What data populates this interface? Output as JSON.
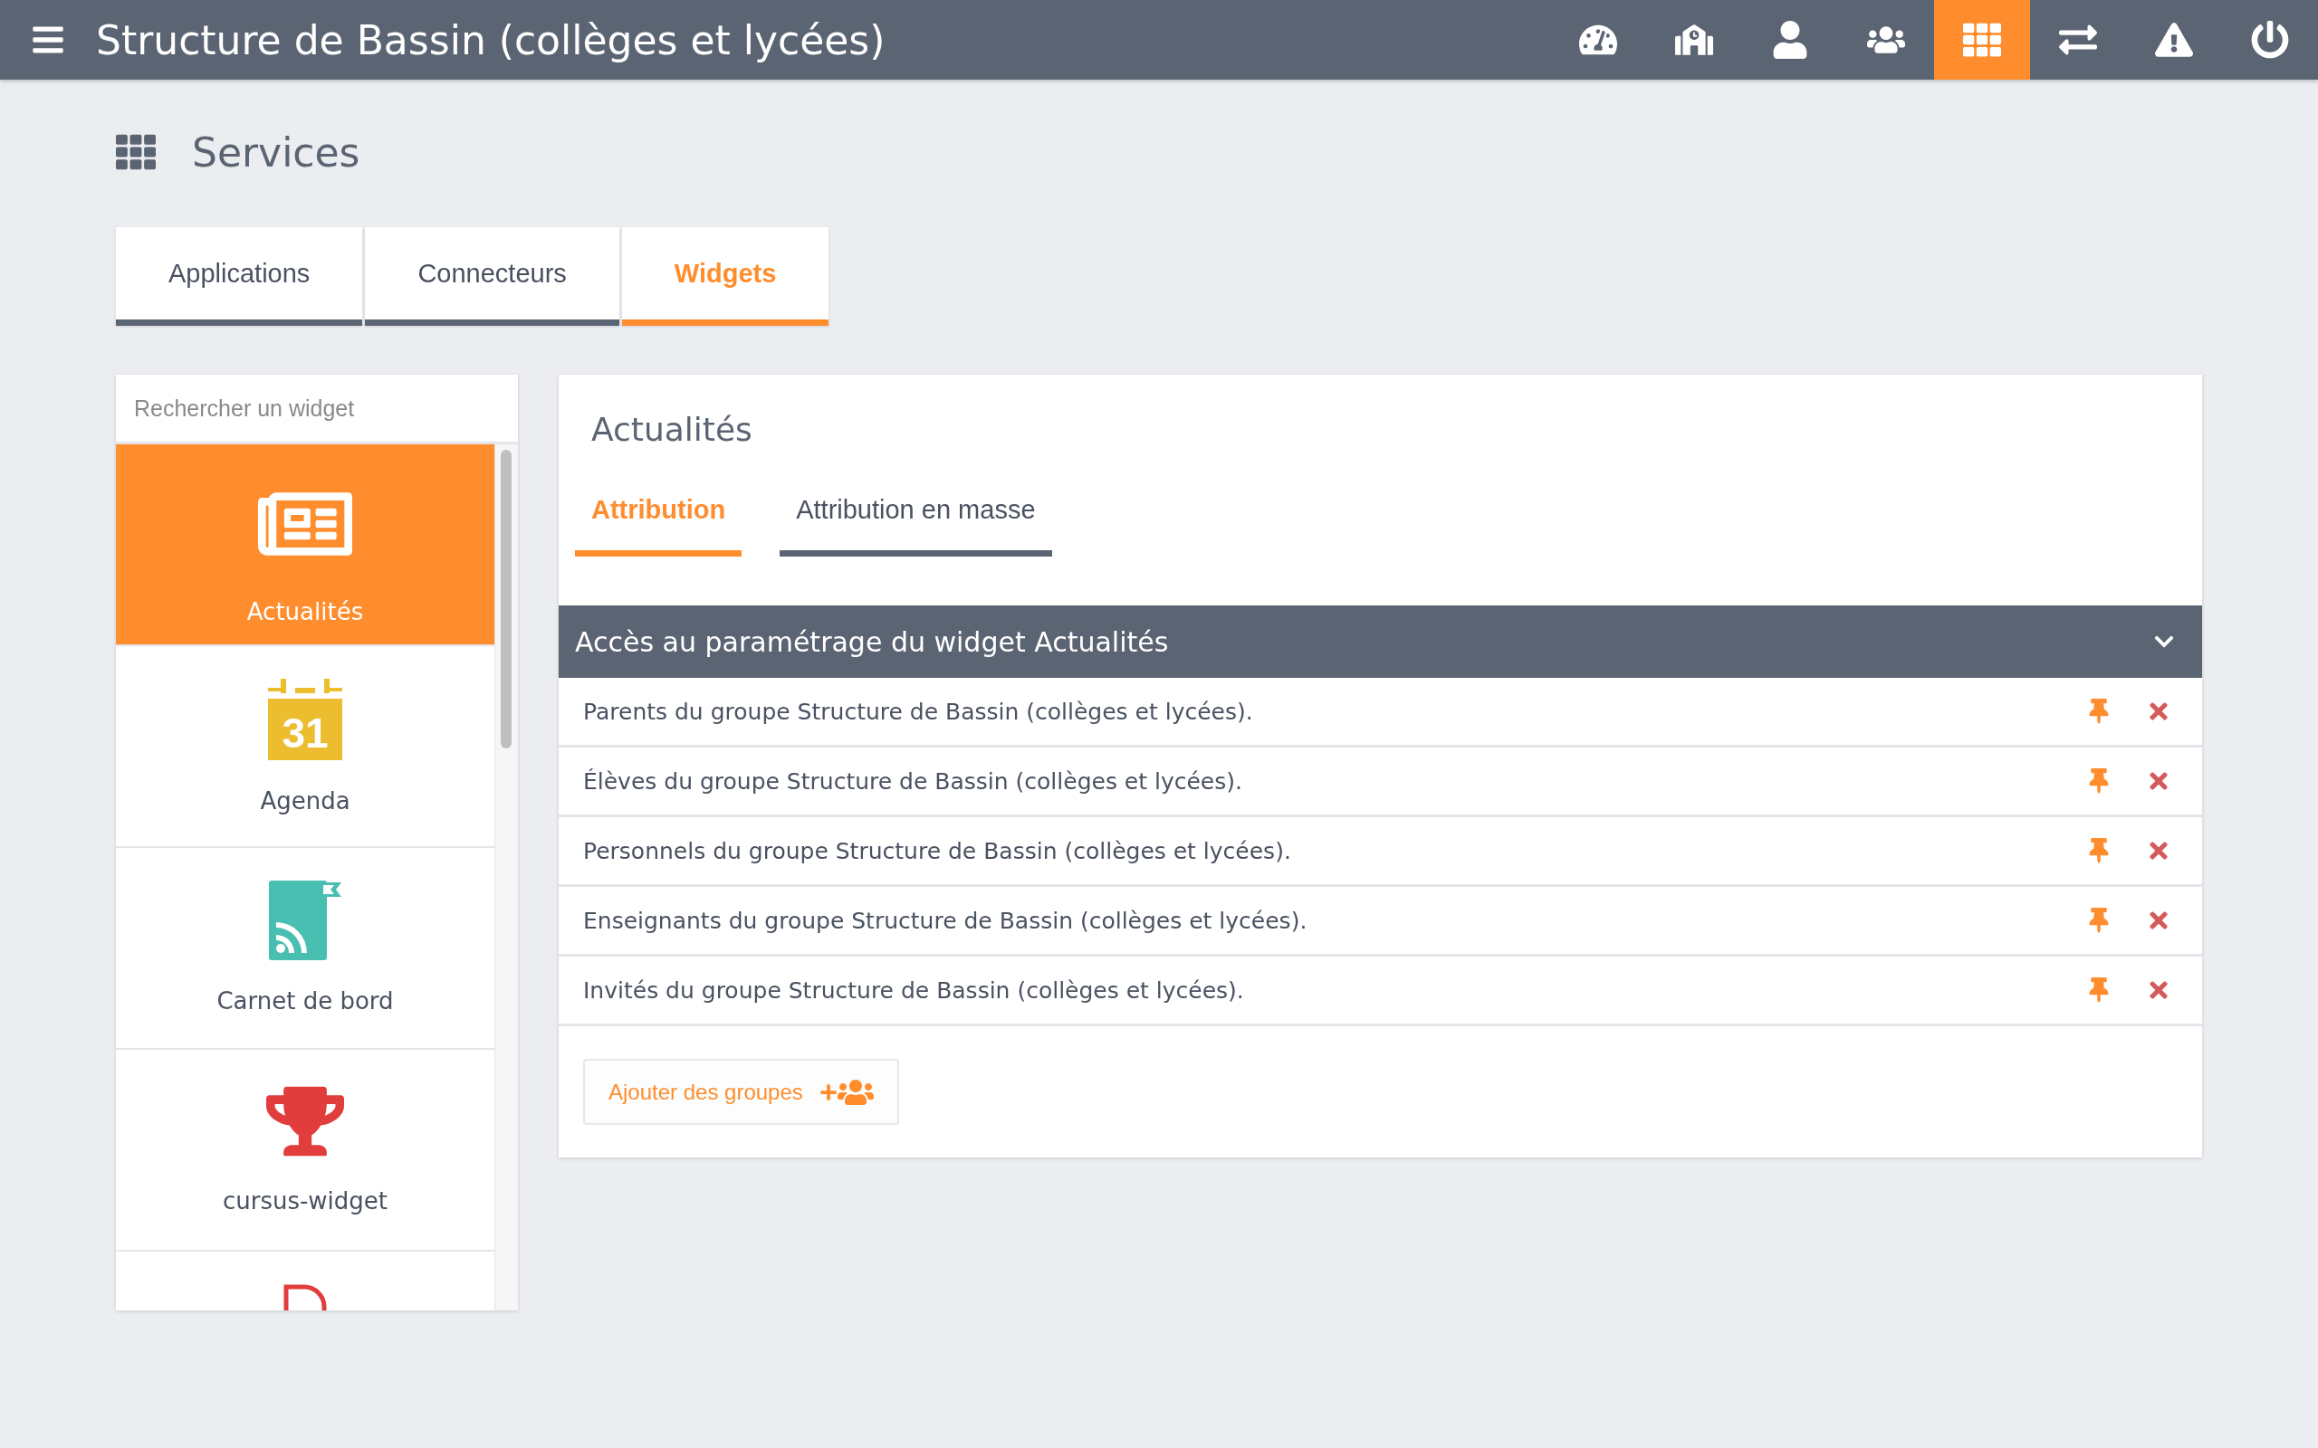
{
  "topbar": {
    "title": "Structure de Bassin (collèges et lycées)",
    "nav": [
      {
        "kind": "gauge",
        "selected": false
      },
      {
        "kind": "school",
        "selected": false
      },
      {
        "kind": "user",
        "selected": false
      },
      {
        "kind": "users",
        "selected": false
      },
      {
        "kind": "grid",
        "selected": true
      },
      {
        "kind": "exchange",
        "selected": false
      },
      {
        "kind": "alert",
        "selected": false
      },
      {
        "kind": "power",
        "selected": false
      }
    ]
  },
  "page": {
    "title": "Services"
  },
  "tabs": [
    {
      "label": "Applications",
      "selected": false
    },
    {
      "label": "Connecteurs",
      "selected": false
    },
    {
      "label": "Widgets",
      "selected": true
    }
  ],
  "sidebar": {
    "search": {
      "placeholder": "Rechercher un widget"
    },
    "items": [
      {
        "kind": "news",
        "label": "Actualités",
        "selected": true
      },
      {
        "kind": "calendar",
        "label": "Agenda",
        "icon_text": "31",
        "selected": false
      },
      {
        "kind": "blog",
        "label": "Carnet de bord",
        "selected": false
      },
      {
        "kind": "trophy",
        "label": "cursus-widget",
        "selected": false
      },
      {
        "kind": "document",
        "selected": false
      }
    ]
  },
  "detail": {
    "title": "Actualités",
    "subtabs": [
      {
        "label": "Attribution",
        "selected": true
      },
      {
        "label": "Attribution en masse",
        "selected": false
      }
    ],
    "accordion": {
      "title": "Accès au paramétrage du widget Actualités",
      "expanded": true,
      "rows": [
        {
          "text": "Parents du groupe Structure de Bassin (collèges et lycées)."
        },
        {
          "text": "Élèves du groupe Structure de Bassin (collèges et lycées)."
        },
        {
          "text": "Personnels du groupe Structure de Bassin (collèges et lycées)."
        },
        {
          "text": "Enseignants du groupe Structure de Bassin (collèges et lycées)."
        },
        {
          "text": "Invités du groupe Structure de Bassin (collèges et lycées)."
        }
      ]
    },
    "add_button": {
      "label": "Ajouter des groupes"
    }
  }
}
